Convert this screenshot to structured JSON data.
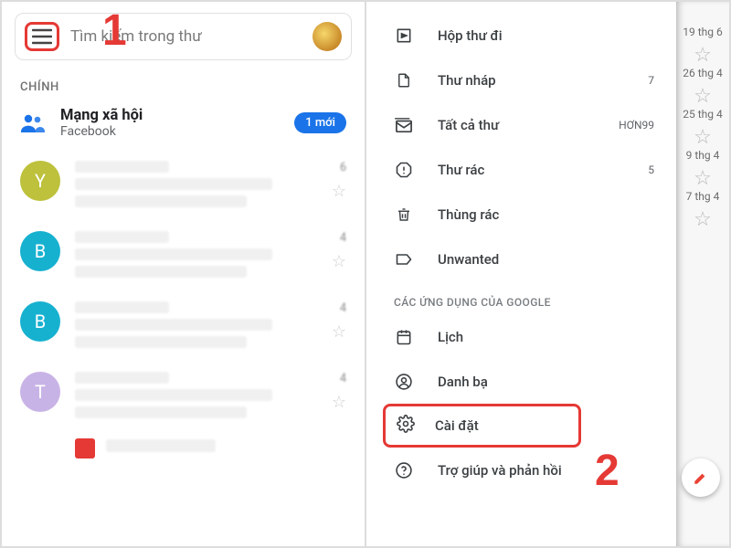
{
  "left": {
    "search_placeholder": "Tìm kiếm trong thư",
    "section_label": "CHÍNH",
    "social": {
      "title": "Mạng xã hội",
      "subtitle": "Facebook",
      "badge": "1 mới"
    },
    "messages": [
      {
        "initial": "Y",
        "colorClass": "c-y",
        "meta": "6"
      },
      {
        "initial": "B",
        "colorClass": "c-b",
        "meta": "4"
      },
      {
        "initial": "B",
        "colorClass": "c-b",
        "meta": "4"
      },
      {
        "initial": "T",
        "colorClass": "c-t",
        "meta": "4"
      }
    ]
  },
  "drawer": {
    "items_top": [
      {
        "icon": "outbox",
        "label": "Hộp thư đi",
        "count": ""
      },
      {
        "icon": "draft",
        "label": "Thư nháp",
        "count": "7"
      },
      {
        "icon": "allmail",
        "label": "Tất cả thư",
        "count": "HƠN99"
      },
      {
        "icon": "spam",
        "label": "Thư rác",
        "count": "5"
      },
      {
        "icon": "trash",
        "label": "Thùng rác",
        "count": ""
      },
      {
        "icon": "label",
        "label": "Unwanted",
        "count": ""
      }
    ],
    "section_title": "CÁC ỨNG DỤNG CỦA GOOGLE",
    "items_apps": [
      {
        "icon": "calendar",
        "label": "Lịch"
      },
      {
        "icon": "contacts",
        "label": "Danh bạ"
      }
    ],
    "settings_label": "Cài đặt",
    "help_label": "Trợ giúp và phản hồi"
  },
  "strip": {
    "dates": [
      "19 thg 6",
      "26 thg 4",
      "25 thg 4",
      "9 thg 4",
      "7 thg 4"
    ]
  },
  "annotations": {
    "one": "1",
    "two": "2"
  }
}
